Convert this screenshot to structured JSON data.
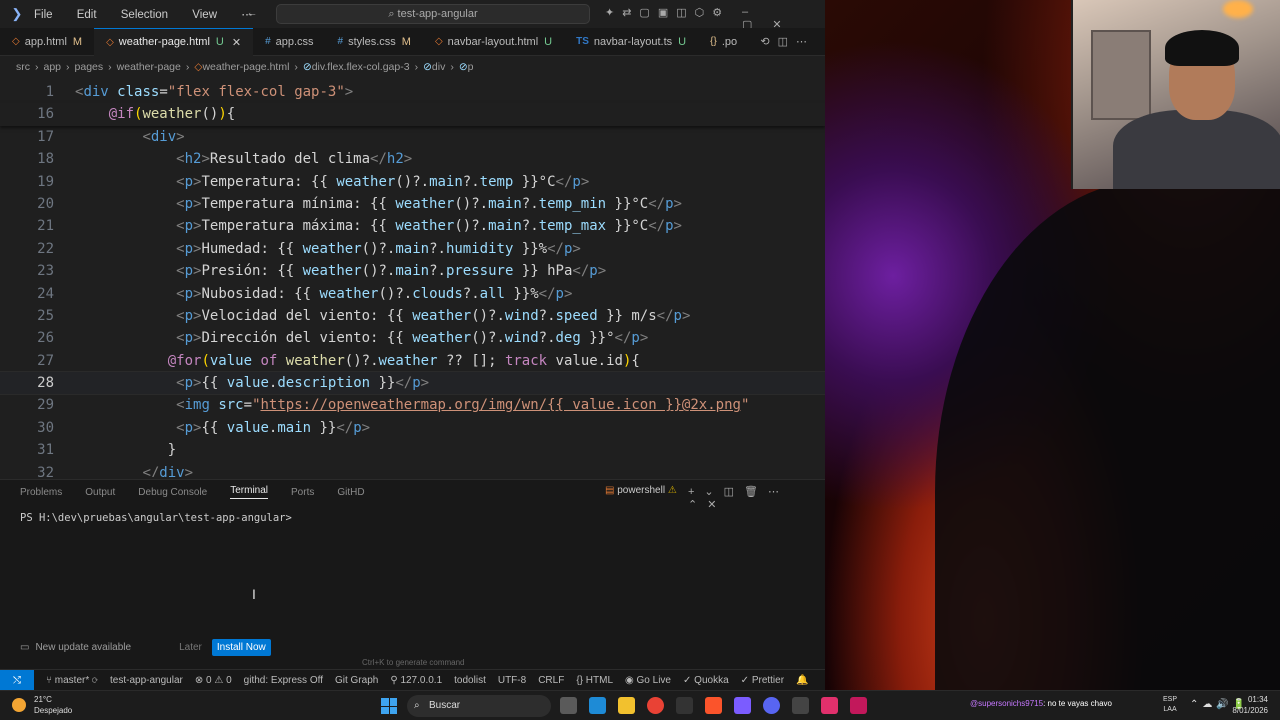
{
  "titlebar": {
    "menus": [
      "File",
      "Edit",
      "Selection",
      "View"
    ],
    "search": "test-app-angular"
  },
  "tabs": [
    {
      "name": "app.html",
      "mod": "M",
      "kind": "html"
    },
    {
      "name": "weather-page.html",
      "mod": "U",
      "kind": "html",
      "active": true
    },
    {
      "name": "app.css",
      "mod": "",
      "kind": "css"
    },
    {
      "name": "styles.css",
      "mod": "M",
      "kind": "css"
    },
    {
      "name": "navbar-layout.html",
      "mod": "U",
      "kind": "html"
    },
    {
      "name": "navbar-layout.ts",
      "mod": "U",
      "kind": "ts"
    },
    {
      "name": ".po",
      "mod": "",
      "kind": "json"
    }
  ],
  "breadcrumb": [
    "src",
    "app",
    "pages",
    "weather-page",
    "weather-page.html",
    "div.flex.flex-col.gap-3",
    "div",
    "p"
  ],
  "lines": [
    {
      "n": "1",
      "sticky": true
    },
    {
      "n": "16",
      "sticky": true
    },
    {
      "n": "17"
    },
    {
      "n": "18"
    },
    {
      "n": "19"
    },
    {
      "n": "20"
    },
    {
      "n": "21"
    },
    {
      "n": "22"
    },
    {
      "n": "23"
    },
    {
      "n": "24"
    },
    {
      "n": "25"
    },
    {
      "n": "26"
    },
    {
      "n": "27"
    },
    {
      "n": "28",
      "current": true
    },
    {
      "n": "29"
    },
    {
      "n": "30"
    },
    {
      "n": "31"
    },
    {
      "n": "32"
    }
  ],
  "panel": {
    "tabs": [
      "Problems",
      "Output",
      "Debug Console",
      "Terminal",
      "Ports",
      "GitHD"
    ],
    "active_tab": "Terminal",
    "shell": "powershell",
    "prompt": "PS H:\\dev\\pruebas\\angular\\test-app-angular>",
    "update_text": "New update available",
    "later": "Later",
    "install": "Install Now",
    "ctrlk": "Ctrl+K to generate command"
  },
  "status": {
    "branch": "master*",
    "project": "test-app-angular",
    "problems": "0",
    "warnings": "0",
    "githd": "githd: Express Off",
    "gitgraph": "Git Graph",
    "ip": "127.0.0.1",
    "todolist": "todolist",
    "encoding": "UTF-8",
    "eol": "CRLF",
    "lang": "HTML",
    "golive": "Go Live",
    "quokka": "Quokka",
    "prettier": "Prettier"
  },
  "taskbar": {
    "temp": "21°C",
    "weather": "Despejado",
    "search": "Buscar",
    "chat_user": "@supersonichs9715",
    "chat_msg": ": no te vayas chavo",
    "lang1": "ESP",
    "lang2": "LAA",
    "time": "01:34",
    "date": "8/01/2026"
  },
  "colors": {
    "accent": "#0078d4",
    "editor_bg": "#1f1f1f",
    "tag": "#569cd6",
    "string": "#ce9178",
    "keyword": "#c586c0",
    "function": "#dcdcaa",
    "variable": "#9cdcfe"
  }
}
